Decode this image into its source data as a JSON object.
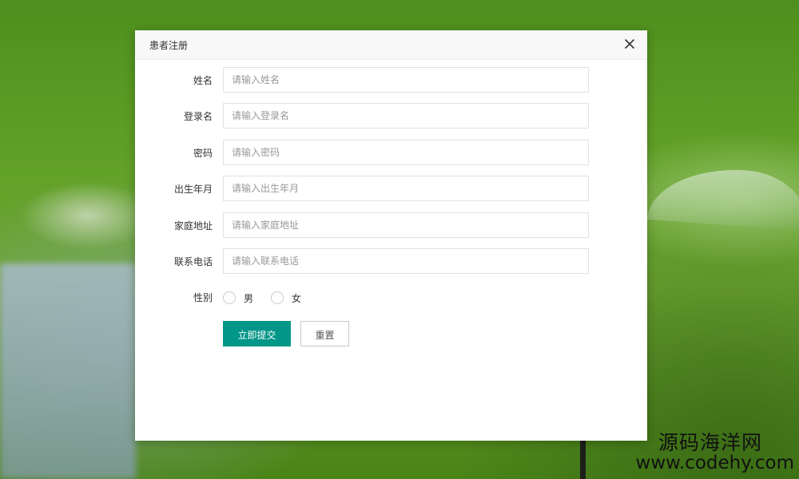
{
  "dialog": {
    "title": "患者注册",
    "close_icon": "close-icon"
  },
  "form": {
    "fields": [
      {
        "label": "姓名",
        "placeholder": "请输入姓名",
        "value": ""
      },
      {
        "label": "登录名",
        "placeholder": "请输入登录名",
        "value": ""
      },
      {
        "label": "密码",
        "placeholder": "请输入密码",
        "value": ""
      },
      {
        "label": "出生年月",
        "placeholder": "请输入出生年月",
        "value": ""
      },
      {
        "label": "家庭地址",
        "placeholder": "请输入家庭地址",
        "value": ""
      },
      {
        "label": "联系电话",
        "placeholder": "请输入联系电话",
        "value": ""
      }
    ],
    "gender": {
      "label": "性别",
      "options": [
        "男",
        "女"
      ],
      "selected": ""
    },
    "submit_label": "立即提交",
    "reset_label": "重置"
  },
  "watermark": {
    "name": "源码海洋网",
    "url": "www.codehy.com"
  },
  "colors": {
    "primary": "#009688",
    "dialog_header_bg": "#f8f8f8",
    "input_border": "#e2e2e2",
    "placeholder": "#999999"
  }
}
